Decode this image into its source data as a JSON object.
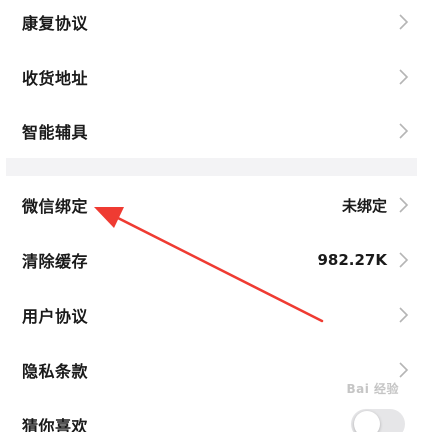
{
  "settings": {
    "items": [
      {
        "label": "康复协议",
        "value": ""
      },
      {
        "label": "收货地址",
        "value": ""
      },
      {
        "label": "智能辅具",
        "value": ""
      },
      {
        "label": "微信绑定",
        "value": "未绑定"
      },
      {
        "label": "清除缓存",
        "value": "982.27K"
      },
      {
        "label": "用户协议",
        "value": ""
      },
      {
        "label": "隐私条款",
        "value": ""
      },
      {
        "label": "猜你喜欢",
        "value": ""
      }
    ],
    "recommend_toggle_on": false
  },
  "annotation": {
    "arrow_color": "#ef3b32"
  },
  "watermark": {
    "text": "Bai 经验"
  },
  "colors": {
    "text": "#1a1a1a",
    "chevron": "#b5b5b5",
    "section_gap": "#f3f3f5"
  }
}
